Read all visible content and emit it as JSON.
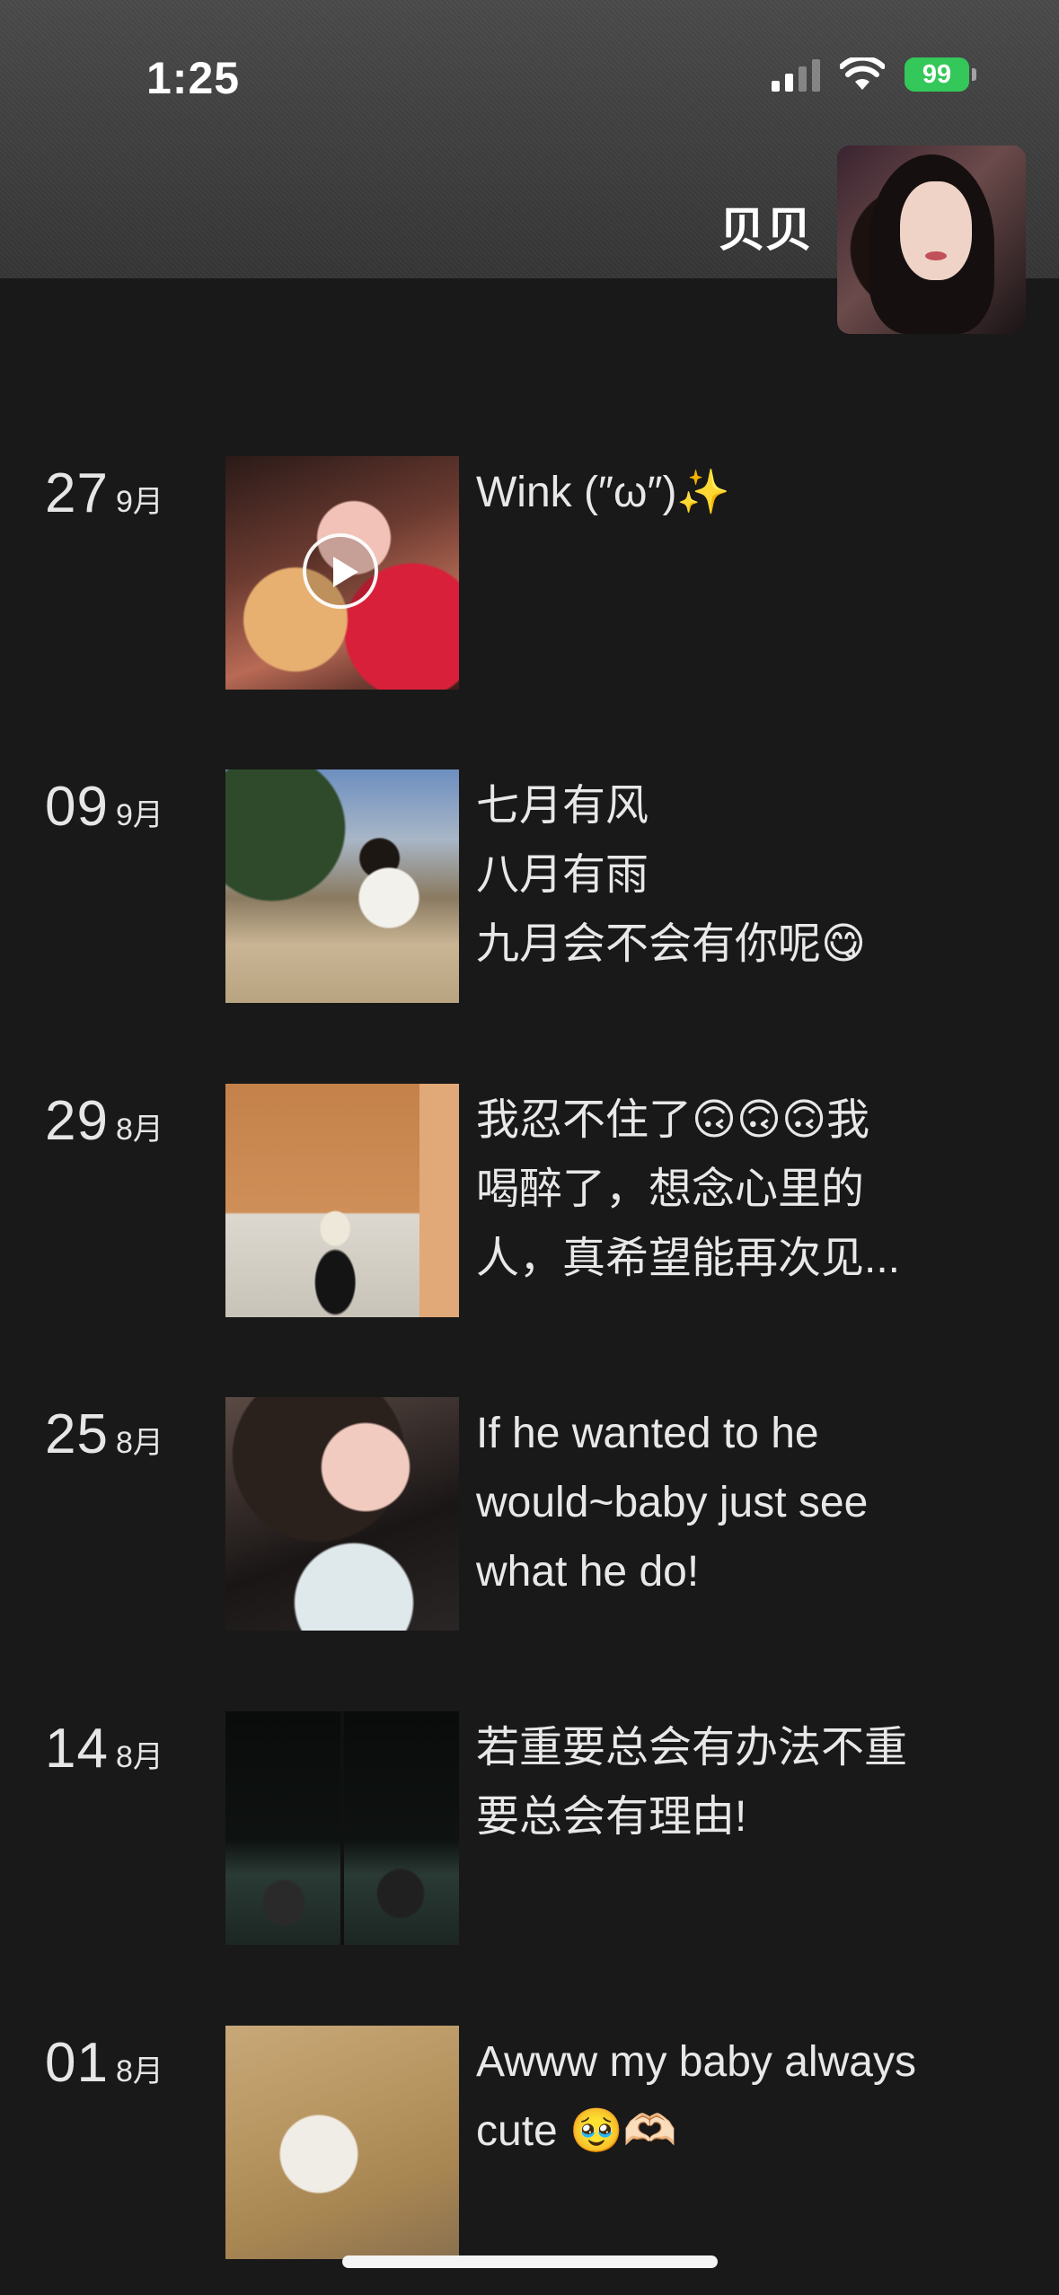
{
  "status_bar": {
    "time": "1:25",
    "battery": "99"
  },
  "profile": {
    "name": "贝贝"
  },
  "posts": [
    {
      "day": "27",
      "month": "9月",
      "caption": [
        "Wink (″ω″)✨"
      ],
      "is_video": true
    },
    {
      "day": "09",
      "month": "9月",
      "caption": [
        "七月有风",
        "八月有雨",
        "九月会不会有你呢😋"
      ],
      "is_video": false
    },
    {
      "day": "29",
      "month": "8月",
      "caption": [
        "我忍不住了🙃🙃🙃我",
        "喝醉了，想念心里的",
        "人，真希望能再次见..."
      ],
      "is_video": false
    },
    {
      "day": "25",
      "month": "8月",
      "caption": [
        "If he wanted to he",
        "would~baby just see",
        "what he do!"
      ],
      "is_video": false
    },
    {
      "day": "14",
      "month": "8月",
      "caption": [
        "若重要总会有办法不重",
        "要总会有理由!"
      ],
      "is_video": false
    },
    {
      "day": "01",
      "month": "8月",
      "caption": [
        "Awww my baby always",
        "cute 🥹🫶🏻"
      ],
      "is_video": false
    }
  ],
  "icons": {
    "signal": "cellular-signal-icon",
    "wifi": "wifi-icon",
    "play": "play-icon"
  }
}
